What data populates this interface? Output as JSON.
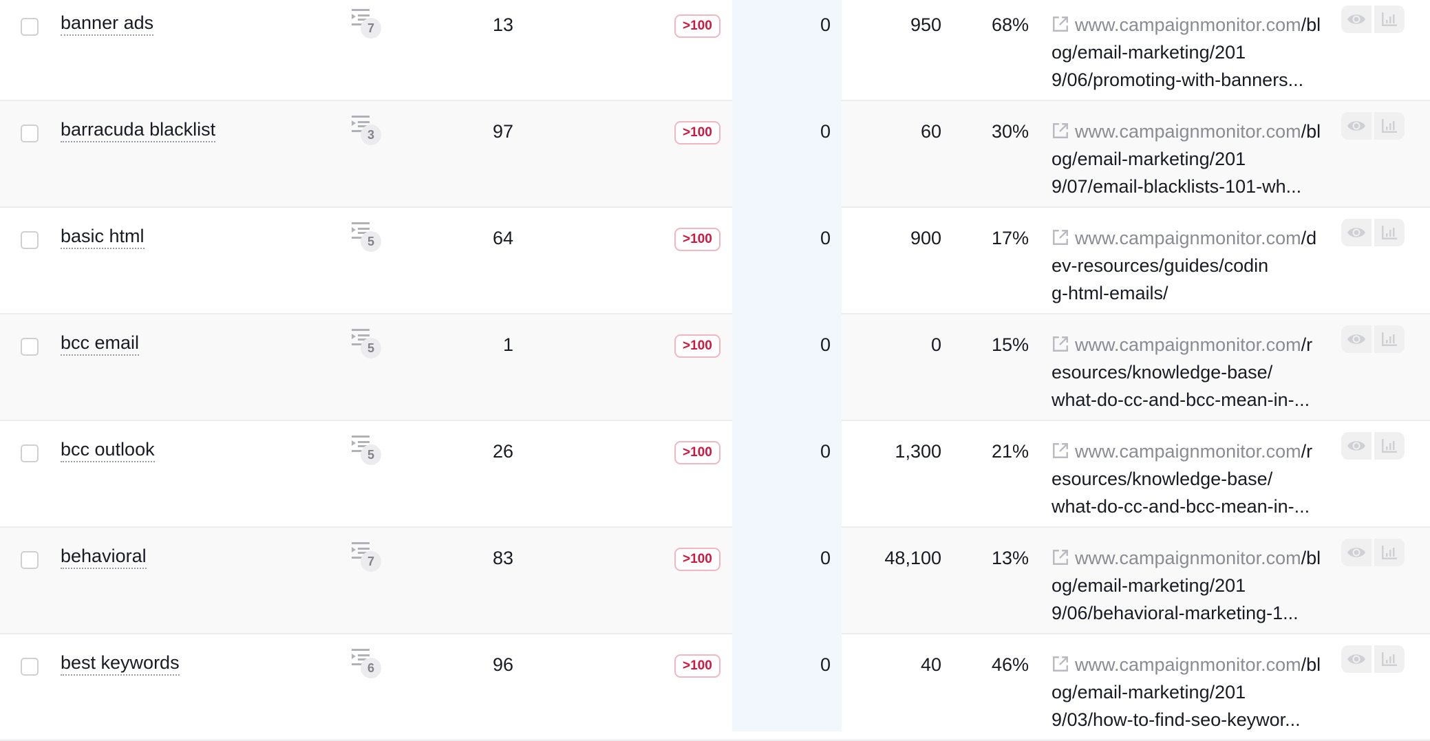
{
  "colors": {
    "highlight_column": "#f2f7fe",
    "badge_text": "#d1173e",
    "badge_border": "#f3b6c0",
    "row_alt": "#f9f9f9",
    "domain_text": "#8a8c93"
  },
  "rows": [
    {
      "keyword": "banner ads",
      "serp_features": "7",
      "volume": "13",
      "position": ">100",
      "highlight_value": "0",
      "value2": "950",
      "percent": "68%",
      "url_domain": "www.campaignmonitor.com",
      "url_path_line": "/blog/email-marketing/201",
      "url_tail": "9/06/promoting-with-banners...",
      "url_domain_part1": "www.campaignmonitor.co",
      "url_domain_part2": "m"
    },
    {
      "keyword": "barracuda blacklist",
      "serp_features": "3",
      "volume": "97",
      "position": ">100",
      "highlight_value": "0",
      "value2": "60",
      "percent": "30%",
      "url_domain_part1": "www.campaignmonitor.co",
      "url_domain_part2": "m",
      "url_path_line": "/blog/email-marketing/201",
      "url_tail": "9/07/email-blacklists-101-wh..."
    },
    {
      "keyword": "basic html",
      "serp_features": "5",
      "volume": "64",
      "position": ">100",
      "highlight_value": "0",
      "value2": "900",
      "percent": "17%",
      "url_domain_part1": "www.campaignmonitor.co",
      "url_domain_part2": "m",
      "url_path_line": "/dev-resources/guides/codin",
      "url_tail": "g-html-emails/"
    },
    {
      "keyword": "bcc email",
      "serp_features": "5",
      "volume": "1",
      "position": ">100",
      "highlight_value": "0",
      "value2": "0",
      "percent": "15%",
      "url_domain_part1": "www.campaignmonitor.co",
      "url_domain_part2": "m",
      "url_path_line": "/resources/knowledge-base/",
      "url_tail": "what-do-cc-and-bcc-mean-in-..."
    },
    {
      "keyword": "bcc outlook",
      "serp_features": "5",
      "volume": "26",
      "position": ">100",
      "highlight_value": "0",
      "value2": "1,300",
      "percent": "21%",
      "url_domain_part1": "www.campaignmonitor.co",
      "url_domain_part2": "m",
      "url_path_line": "/resources/knowledge-base/",
      "url_tail": "what-do-cc-and-bcc-mean-in-..."
    },
    {
      "keyword": "behavioral",
      "serp_features": "7",
      "volume": "83",
      "position": ">100",
      "highlight_value": "0",
      "value2": "48,100",
      "percent": "13%",
      "url_domain_part1": "www.campaignmonitor.co",
      "url_domain_part2": "m",
      "url_path_line": "/blog/email-marketing/201",
      "url_tail": "9/06/behavioral-marketing-1..."
    },
    {
      "keyword": "best keywords",
      "serp_features": "6",
      "volume": "96",
      "position": ">100",
      "highlight_value": "0",
      "value2": "40",
      "percent": "46%",
      "url_domain_part1": "www.campaignmonitor.co",
      "url_domain_part2": "m",
      "url_path_line": "/blog/email-marketing/201",
      "url_tail": "9/03/how-to-find-seo-keywor..."
    }
  ],
  "icons": {
    "serp": "serp-features-icon",
    "external": "external-link-icon",
    "view": "eye-icon",
    "chart": "bar-chart-icon"
  }
}
